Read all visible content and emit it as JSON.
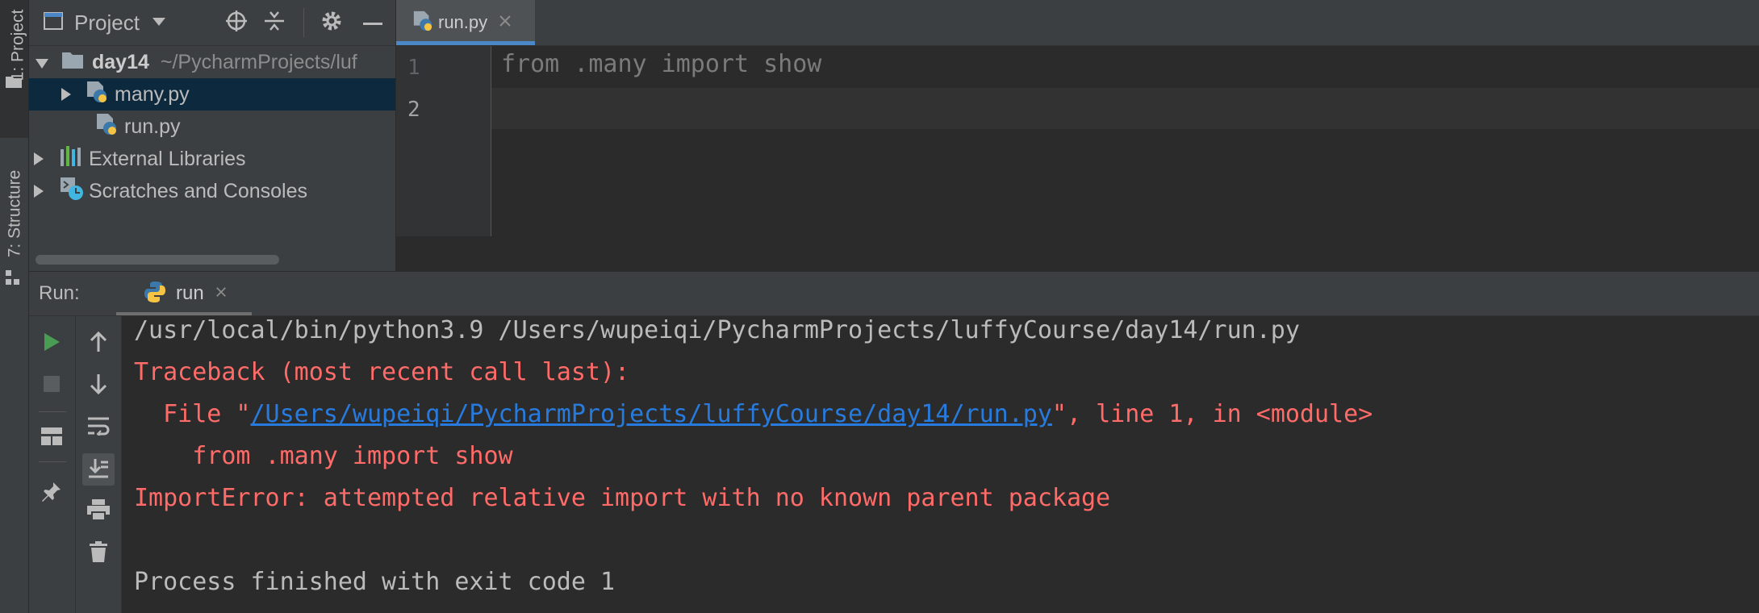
{
  "left_stripe": {
    "project_tab": "1: Project",
    "structure_tab": "7: Structure"
  },
  "project_panel": {
    "title": "Project",
    "tree": [
      {
        "label": "day14",
        "path": "~/PycharmProjects/luf"
      },
      {
        "label": "many.py"
      },
      {
        "label": "run.py"
      },
      {
        "label": "External Libraries"
      },
      {
        "label": "Scratches and Consoles"
      }
    ]
  },
  "editor": {
    "tab_label": "run.py",
    "line_numbers": [
      "1",
      "2"
    ],
    "code_line1": "from .many import show"
  },
  "run": {
    "label": "Run:",
    "tab_label": "run",
    "console": {
      "command": "/usr/local/bin/python3.9 /Users/wupeiqi/PycharmProjects/luffyCourse/day14/run.py",
      "traceback": "Traceback (most recent call last):",
      "file_prefix": "  File \"",
      "file_link": "/Users/wupeiqi/PycharmProjects/luffyCourse/day14/run.py",
      "file_suffix": "\", line 1, in <module>",
      "code": "    from .many import show",
      "error": "ImportError: attempted relative import with no known parent package",
      "exit": "Process finished with exit code 1"
    }
  },
  "colors": {
    "error": "#ff6b68",
    "link": "#287bde",
    "accent": "#4a88c7",
    "selection": "#0d293e",
    "run_green": "#499c54"
  }
}
